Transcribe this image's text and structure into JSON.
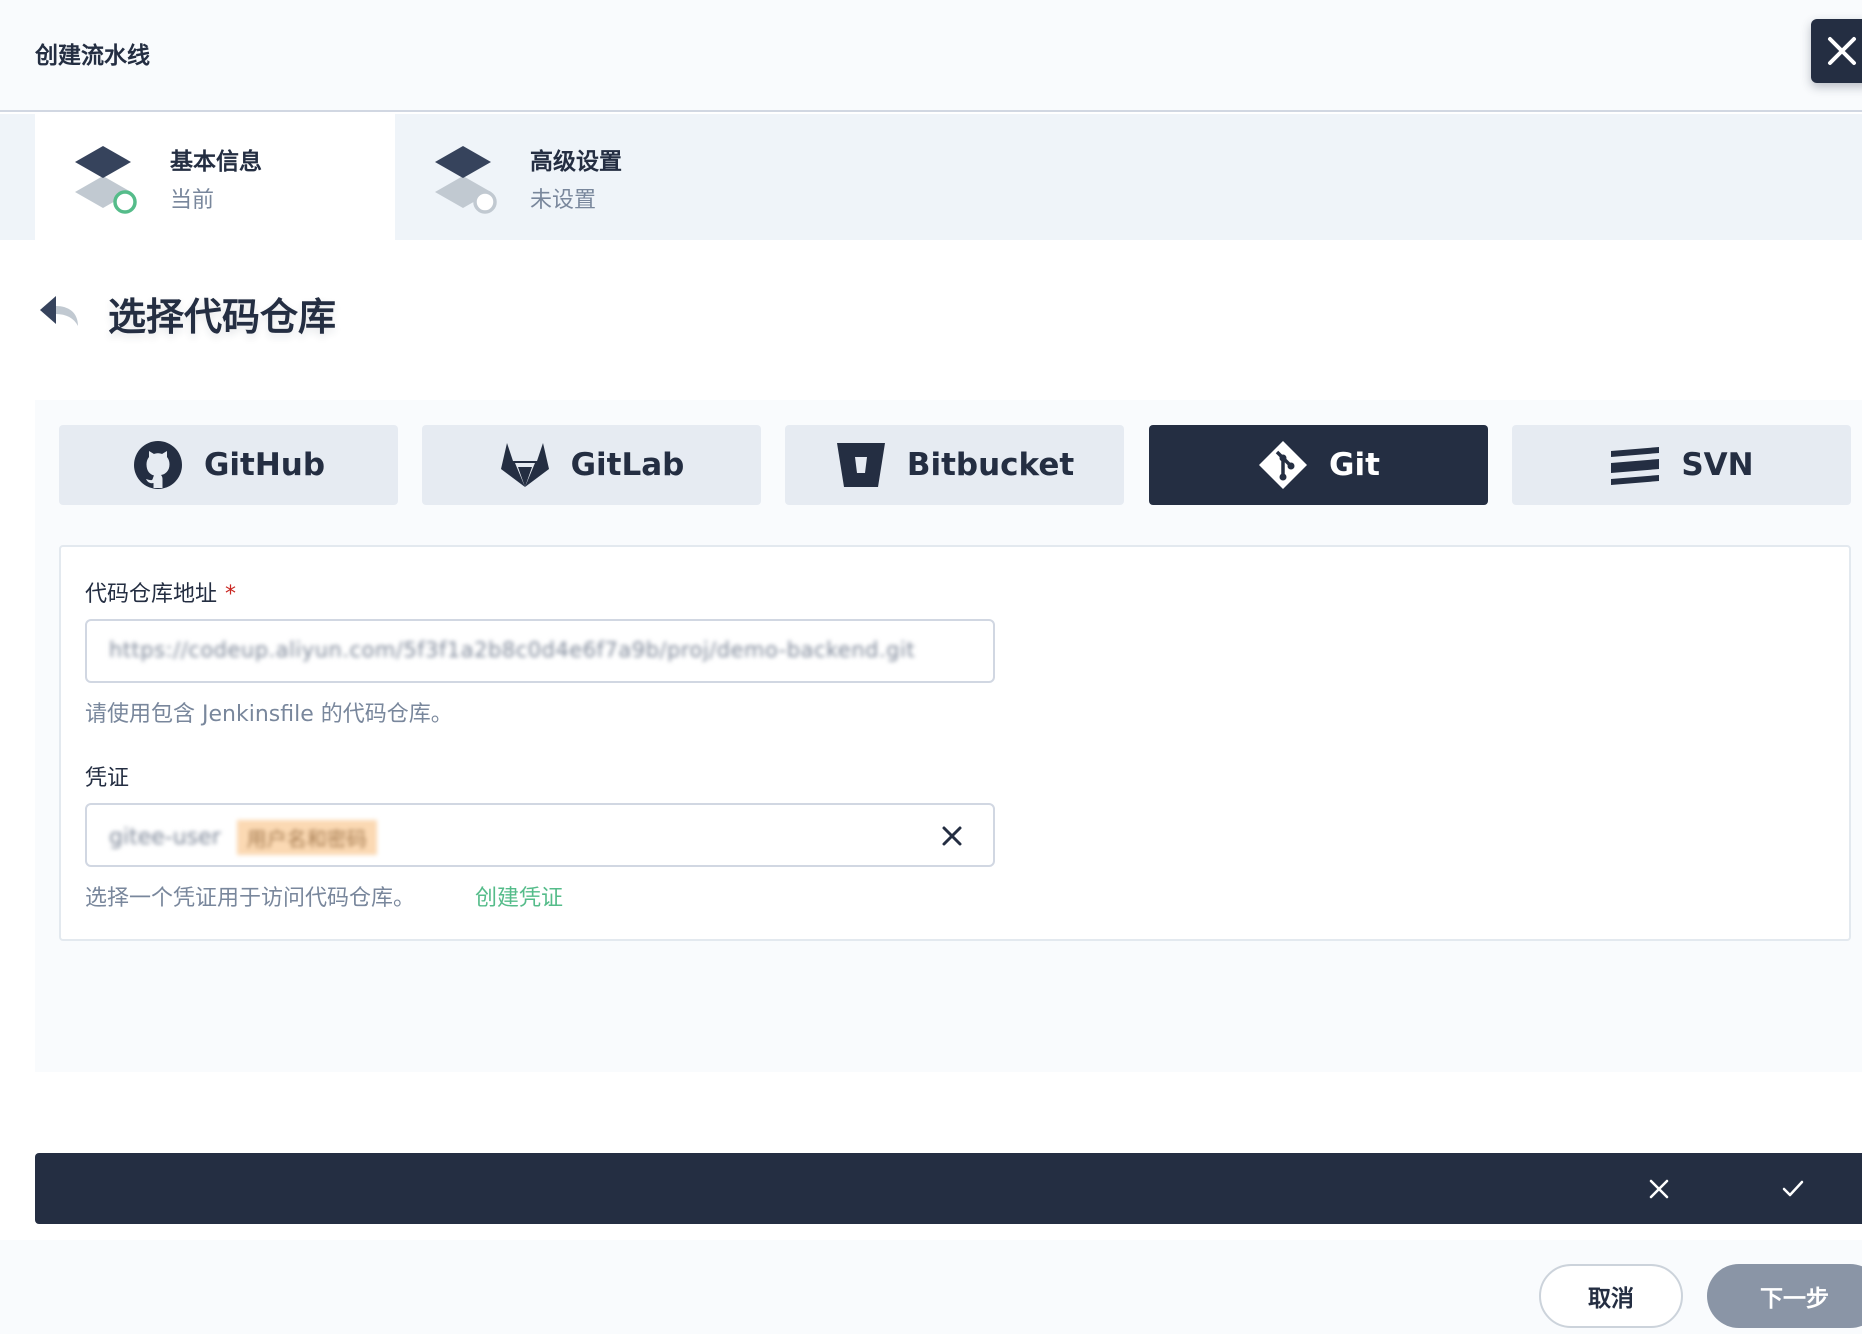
{
  "header": {
    "title": "创建流水线"
  },
  "steps": [
    {
      "title": "基本信息",
      "status": "当前"
    },
    {
      "title": "高级设置",
      "status": "未设置"
    }
  ],
  "section": {
    "title": "选择代码仓库"
  },
  "repo_tabs": [
    {
      "label": "GitHub",
      "icon": "github-icon"
    },
    {
      "label": "GitLab",
      "icon": "gitlab-icon"
    },
    {
      "label": "Bitbucket",
      "icon": "bitbucket-icon"
    },
    {
      "label": "Git",
      "icon": "git-icon",
      "selected": true
    },
    {
      "label": "SVN",
      "icon": "svn-icon"
    }
  ],
  "form": {
    "repo_url": {
      "label": "代码仓库地址",
      "required_mark": "*",
      "value": "https://codeup.aliyun.com/5f3f1a2b8c0d4e6f7a9b/proj/demo-backend.git",
      "help": "请使用包含 Jenkinsfile 的代码仓库。"
    },
    "credential": {
      "label": "凭证",
      "value_name": "gitee-user",
      "value_tag": "用户名和密码",
      "help": "选择一个凭证用于访问代码仓库。",
      "link": "创建凭证"
    }
  },
  "footer": {
    "cancel": "取消",
    "next": "下一步"
  },
  "colors": {
    "primary_dark": "#242e42",
    "accent_green": "#55bc8a",
    "required_red": "#ca2621",
    "panel_bg": "#f9fbfd"
  }
}
